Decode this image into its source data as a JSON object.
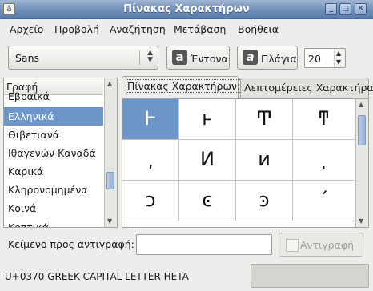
{
  "window": {
    "title": "Πίνακας Χαρακτήρων",
    "app_icon_glyph": "á",
    "controls": {
      "minimize": "_",
      "maximize": "□",
      "close": "✕"
    }
  },
  "menu": [
    {
      "label": "Αρχείο"
    },
    {
      "label": "Προβολή"
    },
    {
      "label": "Αναζήτηση"
    },
    {
      "label": "Μετάβαση"
    },
    {
      "label": "Βοήθεια"
    }
  ],
  "toolbar": {
    "font_family": "Sans",
    "bold_label": "Έντονα",
    "bold_icon_glyph": "a",
    "italic_label": "Πλάγια",
    "italic_icon_glyph": "a",
    "font_size": "20"
  },
  "scripts": {
    "header": "Γραφή",
    "items": [
      {
        "label": "Εβραϊκά"
      },
      {
        "label": "Ελληνικά"
      },
      {
        "label": "Θιβετιανά"
      },
      {
        "label": "Ιθαγενών Καναδά"
      },
      {
        "label": "Καρικά"
      },
      {
        "label": "Κληρονομημένα"
      },
      {
        "label": "Κοινά"
      },
      {
        "label": "Κοπτικά"
      }
    ],
    "selected_index": 1
  },
  "tabs": [
    {
      "label": "Πίνακας Χαρακτήρων:"
    },
    {
      "label": "Λεπτομέρειες Χαρακτήρα"
    }
  ],
  "char_grid": {
    "cells": [
      "Ͱ",
      "ͱ",
      "Ͳ",
      "ͳ",
      "͵",
      "Ͷ",
      "ͷ",
      "ͺ",
      "ͻ",
      "ͼ",
      "ͽ",
      "΄"
    ],
    "selected_index": 0
  },
  "copy": {
    "label": "Κείμενο προς αντιγραφή:",
    "value": "",
    "button_label": "Αντιγραφή"
  },
  "status": {
    "text": "U+0370 GREEK CAPITAL LETTER HETA"
  }
}
